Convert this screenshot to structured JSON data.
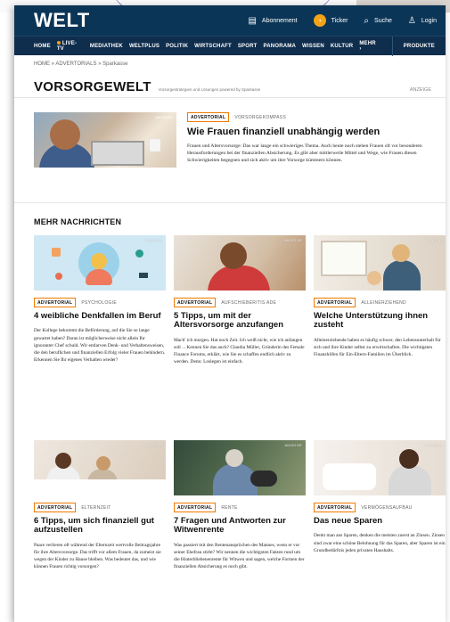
{
  "header": {
    "logo": "WELT",
    "abonnement": "Abonnement",
    "ticker": "Ticker",
    "suche": "Suche",
    "login": "Login"
  },
  "nav": {
    "items": [
      "HOME",
      "LIVE-TV",
      "MEDIATHEK",
      "WELTPLUS",
      "POLITIK",
      "WIRTSCHAFT",
      "SPORT",
      "PANORAMA",
      "WISSEN",
      "KULTUR",
      "MEHR"
    ],
    "produkte": "PRODUKTE"
  },
  "breadcrumb": "HOME » ADVERTORIALS » Sparkasse",
  "section": {
    "title": "VORSORGEWELT",
    "subtitle": "Vorsorgestrategien und Lösungen powered by Sparkasse",
    "badge": "ANZEIGE"
  },
  "featured": {
    "tag": "ADVERTORIAL",
    "category": "VORSORGEKOMPASS",
    "anzeige": "ANZEIGE",
    "title": "Wie Frauen finanziell unabhängig werden",
    "text": "Frauen und Altersvorsorge: Das war lange ein schwieriges Thema. Auch heute noch stehen Frauen oft vor besonderen Herausforderungen bei der finanziellen Absicherung. Es gibt aber mittlerweile Mittel und Wege, wie Frauen diesen Schwierigkeiten begegnen und sich aktiv um ihre Vorsorge kümmern können."
  },
  "mehr_title": "MEHR NACHRICHTEN",
  "cards": [
    {
      "tag": "ADVERTORIAL",
      "category": "PSYCHOLOGIE",
      "anzeige": "ANZEIGE",
      "title": "4 weibliche Denkfallen im Beruf",
      "text": "Der Kollege bekommt die Beförderung, auf die Sie so lange gewartet haben? Daran ist möglicherweise nicht allein Ihr ignoranter Chef schuld. Wir entlarven Denk- und Verhaltensweisen, die den beruflichen und finanziellen Erfolg vieler Frauen behindern. Erkennen Sie Ihr eigenes Verhalten wieder?"
    },
    {
      "tag": "ADVERTORIAL",
      "category": "AUFSCHIEBERITIS ADE",
      "anzeige": "ANZEIGE",
      "title": "5 Tipps, um mit der Altersvorsorge anzufangen",
      "text": "Mach' ich morgen. Hat noch Zeit. Ich weiß nicht, wie ich anfangen soll ... Kennen Sie das auch? Claudia Müller, Gründerin des Female Finance Forums, erklärt, wie Sie es schaffen endlich aktiv zu werden. Denn: Loslegen ist einfach."
    },
    {
      "tag": "ADVERTORIAL",
      "category": "ALLEINERZIEHEND",
      "anzeige": "ANZEIGE",
      "title": "Welche Unterstützung ihnen zusteht",
      "text": "Alleinerziehende haben es häufig schwer, den Lebensunterhalt für sich und ihre Kinder selbst zu erwirtschaften. Die wichtigsten Finanzhilfen für Ein-Eltern-Familien im Überblick."
    },
    {
      "tag": "ADVERTORIAL",
      "category": "ELTERNZEIT",
      "anzeige": "ANZEIGE",
      "title": "6 Tipps, um sich finanziell gut aufzustellen",
      "text": "Paare verlieren oft während der Elternzeit wertvolle Beitragsjahre für ihre Altersvorsorge. Das trifft vor allem Frauen, da zumeist sie wegen der Kinder zu Hause bleiben. Was bedeutet das, und wie können Frauen richtig vorsorgen?"
    },
    {
      "tag": "ADVERTORIAL",
      "category": "RENTE",
      "anzeige": "ANZEIGE",
      "title": "7 Fragen und Antworten zur Witwenrente",
      "text": "Was passiert mit den Rentenansprüchen des Mannes, wenn er vor seiner Ehefrau stirbt? Wir nennen die wichtigsten Fakten rund um die Hinterbliebenenrente für Witwen und sagen, welche Formen der finanziellen Absicherung es noch gibt."
    },
    {
      "tag": "ADVERTORIAL",
      "category": "VERMÖGENSAUFBAU",
      "anzeige": "ANZEIGE",
      "title": "Das neue Sparen",
      "text": "Denkt man ans Sparen, denken die meisten zuerst an Zinsen. Zinsen sind zwar eine schöne Belohnung für das Sparen, aber Sparen ist ein Grundbedürfnis jeden privaten Haushalts."
    }
  ],
  "colors": {
    "header_bg": "#0b3556",
    "nav_bg": "#0f2d4c",
    "accent": "#ef7a00",
    "live": "#f3a315"
  },
  "icons": [
    "newspaper-icon",
    "ticker-icon",
    "search-icon",
    "user-icon",
    "chevron-right-icon"
  ]
}
